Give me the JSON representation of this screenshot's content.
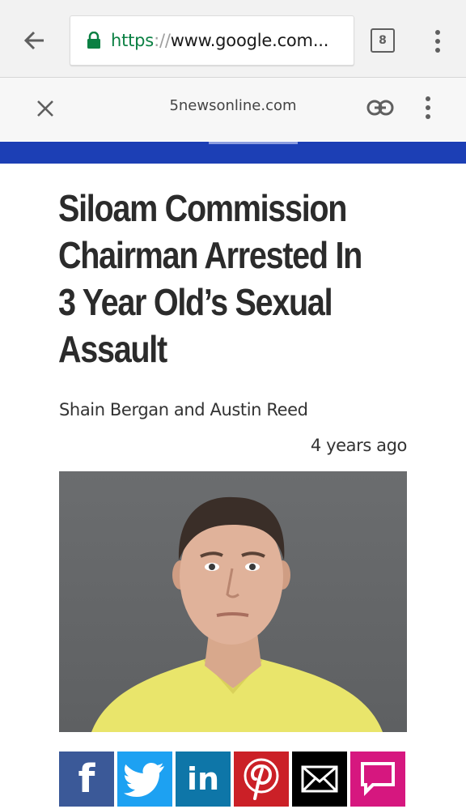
{
  "browser": {
    "url_scheme": "https",
    "url_separator": "://",
    "url_host": "www.google.com...",
    "tab_count": "8",
    "icons": [
      "back-arrow-icon",
      "lock-icon",
      "more-vert-icon"
    ]
  },
  "custom_tab": {
    "domain": "5newsonline.com",
    "icons": [
      "close-icon",
      "link-icon",
      "more-vert-icon"
    ]
  },
  "site_header": {
    "color": "#1c3fb5"
  },
  "article": {
    "headline_lines": [
      "Siloam Commission",
      "Chairman Arrested In",
      "3 Year Old’s Sexual",
      "Assault"
    ],
    "byline": "Shain Bergan and Austin Reed",
    "timestamp": "4 years ago"
  },
  "share": {
    "buttons": [
      {
        "name": "facebook",
        "label": "f",
        "color": "#3b5998"
      },
      {
        "name": "twitter",
        "label": "",
        "color": "#1da1f2"
      },
      {
        "name": "linkedin",
        "label": "in",
        "color": "#0e76a8"
      },
      {
        "name": "pinterest",
        "label": "",
        "color": "#cb2027"
      },
      {
        "name": "email",
        "label": "",
        "color": "#000000"
      },
      {
        "name": "comment",
        "label": "",
        "color": "#d6177f"
      }
    ]
  },
  "colors": {
    "url_scheme": "#0b8043",
    "headline": "#2b2b2b"
  }
}
